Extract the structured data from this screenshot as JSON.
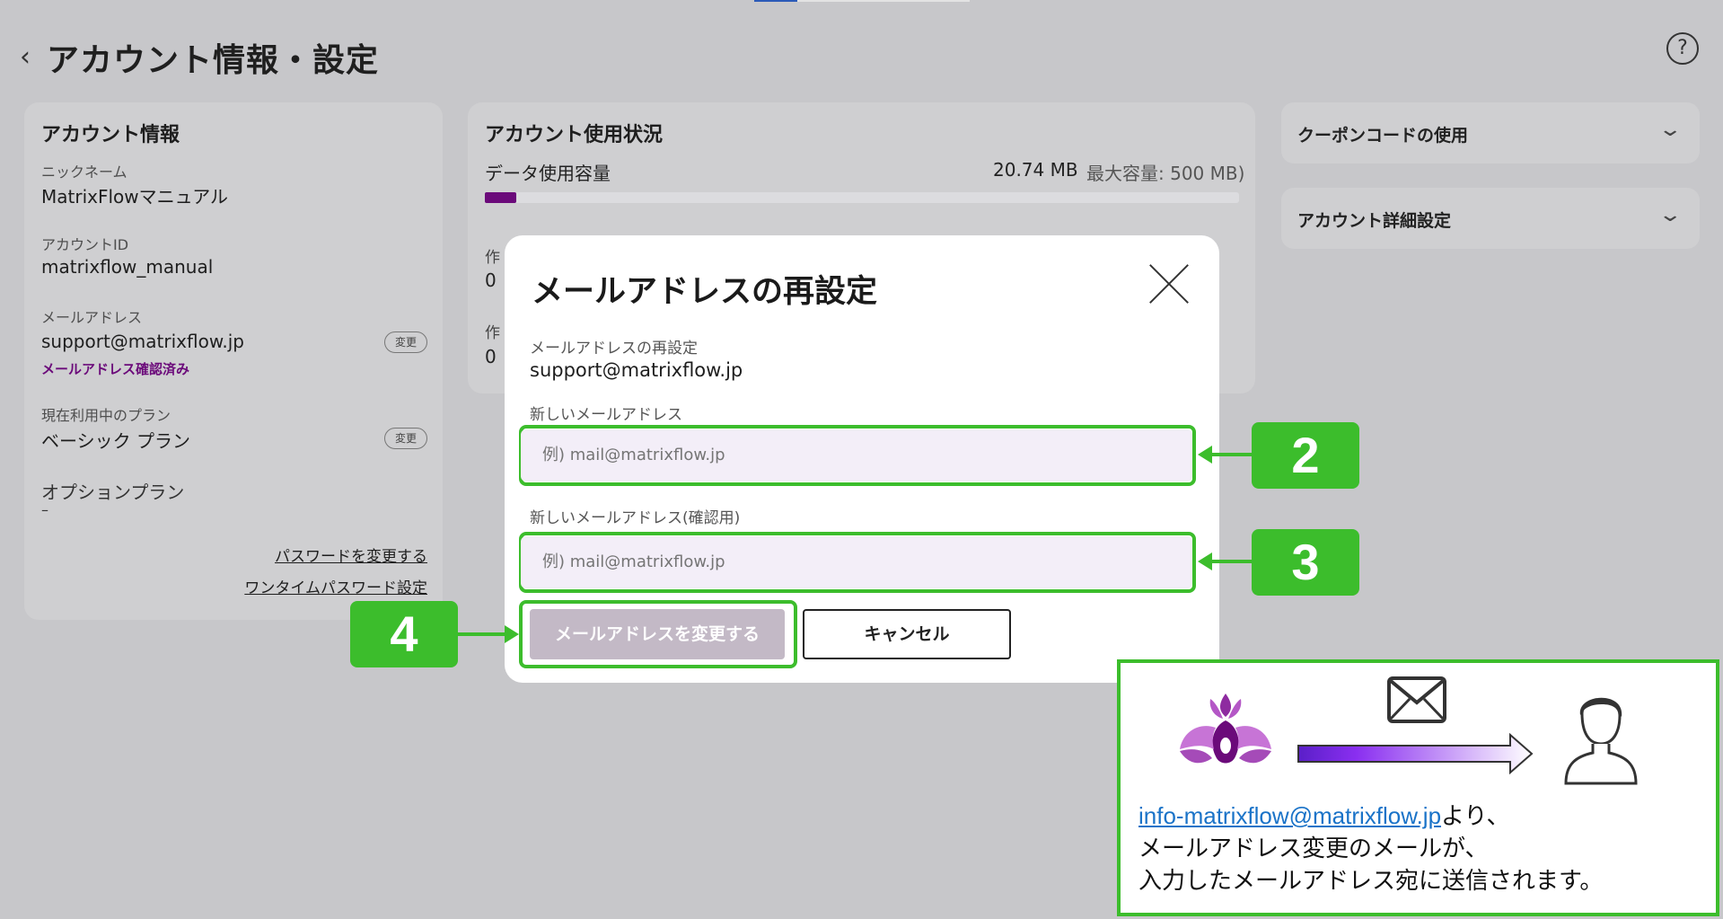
{
  "page": {
    "title": "アカウント情報・設定",
    "help_label": "?"
  },
  "account_info": {
    "heading": "アカウント情報",
    "nickname_label": "ニックネーム",
    "nickname_value": "MatrixFlowマニュアル",
    "account_id_label": "アカウントID",
    "account_id_value": "matrixflow_manual",
    "email_label": "メールアドレス",
    "email_value": "support@matrixflow.jp",
    "email_change_label": "変更",
    "email_verified_label": "メールアドレス確認済み",
    "plan_label": "現在利用中のプラン",
    "plan_value": "ベーシック プラン",
    "plan_change_label": "変更",
    "option_plan_label": "オプションプラン",
    "option_plan_value": "–",
    "change_password_link": "パスワードを変更する",
    "otp_link": "ワンタイムパスワード設定"
  },
  "usage": {
    "heading": "アカウント使用状況",
    "data_label": "データ使用容量",
    "data_used": "20.74 MB",
    "data_max": "最大容量: 500 MB)",
    "usage_fraction": 0.0415,
    "row1_label": "作",
    "row1_value": "0",
    "row2_label": "作",
    "row2_value": "0"
  },
  "accordions": [
    {
      "label": "クーポンコードの使用",
      "icon": "chevron-down-icon"
    },
    {
      "label": "アカウント詳細設定",
      "icon": "chevron-down-icon"
    }
  ],
  "modal": {
    "title": "メールアドレスの再設定",
    "current_label": "メールアドレスの再設定",
    "current_value": "support@matrixflow.jp",
    "new_email_label": "新しいメールアドレス",
    "new_email_placeholder": "例) mail@matrixflow.jp",
    "confirm_email_label": "新しいメールアドレス(確認用)",
    "confirm_email_placeholder": "例) mail@matrixflow.jp",
    "submit_label": "メールアドレスを変更する",
    "cancel_label": "キャンセル"
  },
  "callouts": [
    "2",
    "3",
    "4"
  ],
  "info_box": {
    "sender_email": "info-matrixflow@matrixflow.jp",
    "line1_suffix": "より、",
    "line2": "メールアドレス変更のメールが、",
    "line3": "入力したメールアドレス宛に送信されます。"
  },
  "colors": {
    "accent_purple": "#6b0a7a",
    "callout_green": "#3cbd2c",
    "input_bg": "#f3eef8"
  }
}
